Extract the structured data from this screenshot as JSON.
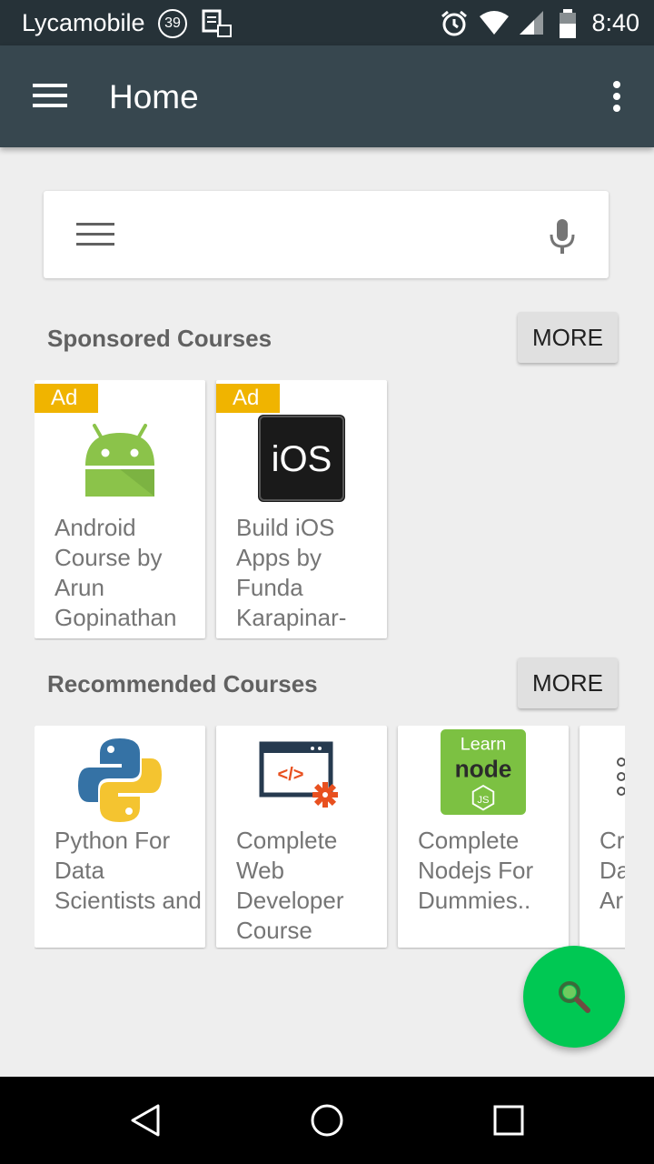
{
  "status_bar": {
    "carrier": "Lycamobile",
    "notification_count": "39",
    "time": "8:40"
  },
  "app_bar": {
    "title": "Home"
  },
  "search": {
    "placeholder": ""
  },
  "sponsored": {
    "heading": "Sponsored Courses",
    "more_label": "MORE",
    "cards": [
      {
        "badge": "Ad",
        "title": "Android Course by Arun Gopinathan",
        "icon": "android-icon"
      },
      {
        "badge": "Ad",
        "title": "Build iOS Apps by Funda Karapinar-",
        "icon": "ios-icon",
        "icon_text": "iOS"
      }
    ]
  },
  "recommended": {
    "heading": "Recommended Courses",
    "more_label": "MORE",
    "cards": [
      {
        "title": "Python For Data Scientists and",
        "icon": "python-icon"
      },
      {
        "title": "Complete Web Developer Course",
        "icon": "web-dev-icon",
        "icon_text": "</>"
      },
      {
        "title": "Complete Nodejs For Dummies..",
        "icon": "nodejs-icon",
        "icon_text_top": "Learn",
        "icon_text_mid": "node",
        "icon_text_bot": "JS"
      },
      {
        "title": "Cr Da Ar",
        "icon": "partial-course-icon"
      }
    ]
  },
  "colors": {
    "status_bar": "#263238",
    "app_bar": "#37474f",
    "ad_badge": "#f0b400",
    "fab": "#00c853"
  }
}
